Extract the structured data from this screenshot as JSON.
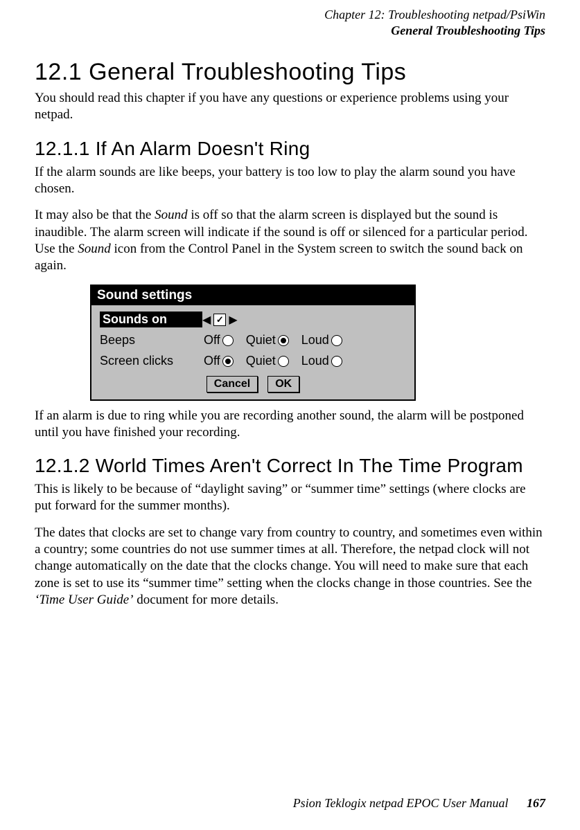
{
  "header": {
    "chapter_line": "Chapter 12:  Troubleshooting netpad/PsiWin",
    "section_line": "General Troubleshooting Tips"
  },
  "s12_1": {
    "heading": "12.1  General Troubleshooting Tips",
    "p1": "You should read this chapter if you have any questions or experience problems using your netpad."
  },
  "s12_1_1": {
    "heading": "12.1.1  If An Alarm Doesn't Ring",
    "p1": "If the alarm sounds are like beeps, your battery is too low to play the alarm sound you have chosen.",
    "p2_pre": "It may also be that the ",
    "p2_it1": "Sound",
    "p2_mid": " is off so that the alarm screen is displayed but the sound is inaudible. The alarm screen will indicate if the sound is off or silenced for a particular period. Use the ",
    "p2_it2": "Sound",
    "p2_post": " icon from the Control Panel in the System screen to switch the sound back on again.",
    "p3": "If an alarm is due to ring while you are recording another sound, the alarm will be postponed until you have finished your recording."
  },
  "dialog": {
    "title": "Sound settings",
    "rows": {
      "sounds_on": {
        "label": "Sounds on",
        "checked": true
      },
      "beeps": {
        "label": "Beeps",
        "opts": [
          "Off",
          "Quiet",
          "Loud"
        ],
        "selected": "Quiet"
      },
      "clicks": {
        "label": "Screen clicks",
        "opts": [
          "Off",
          "Quiet",
          "Loud"
        ],
        "selected": "Off"
      }
    },
    "buttons": {
      "cancel": "Cancel",
      "ok": "OK"
    }
  },
  "s12_1_2": {
    "heading": "12.1.2  World Times Aren't Correct In The Time Program",
    "p1": "This is likely to be because of “daylight saving” or “summer time” settings (where clocks are put forward for the summer months).",
    "p2_pre": "The dates that clocks are set to change vary from country to country, and sometimes even within a country; some countries do not use summer times at all. Therefore, the netpad clock will not change automatically on the date that the clocks change. You will need to make sure that each zone is set to use its “summer time” setting when the clocks change in those countries. See the ",
    "p2_it": "‘Time User Guide’",
    "p2_post": " document for more details."
  },
  "footer": {
    "text": "Psion Teklogix netpad EPOC User Manual",
    "page": "167"
  }
}
